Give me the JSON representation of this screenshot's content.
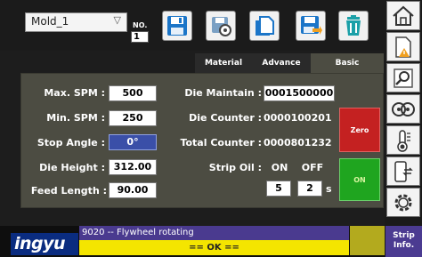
{
  "header": {
    "mold_select": "Mold_1",
    "no_label": "NO.",
    "no_value": "1",
    "toolbar_icons": [
      "save-icon",
      "settings-save-icon",
      "copy-icon",
      "save-as-icon",
      "delete-icon"
    ]
  },
  "tabs": [
    {
      "label": "Material",
      "active": false
    },
    {
      "label": "Advance",
      "active": false
    },
    {
      "label": "Basic",
      "active": true
    }
  ],
  "fields": {
    "max_spm": {
      "label": "Max. SPM :",
      "value": "500"
    },
    "min_spm": {
      "label": "Min. SPM :",
      "value": "250"
    },
    "stop_angle": {
      "label": "Stop Angle :",
      "value": "0°"
    },
    "die_height": {
      "label": "Die Height :",
      "value": "312.00"
    },
    "feed_length": {
      "label": "Feed Length :",
      "value": "90.00"
    },
    "die_maintain": {
      "label": "Die Maintain :",
      "value": "0001500000"
    },
    "die_counter": {
      "label": "Die Counter :",
      "value": "0000100201"
    },
    "total_counter": {
      "label": "Total Counter :",
      "value": "0000801232"
    },
    "strip_oil": {
      "label": "Strip Oil :",
      "on_label": "ON",
      "off_label": "OFF",
      "on_value": "5",
      "off_value": "2",
      "unit": "s"
    }
  },
  "buttons": {
    "zero": "Zero",
    "on": "ON"
  },
  "sidebar_icons": [
    "home-icon",
    "alarm-document-icon",
    "search-icon",
    "motor-icon",
    "temperature-icon",
    "device-transfer-icon",
    "gear-icon"
  ],
  "status": {
    "logo": "ingyu",
    "message": "9020   -- Flywheel rotating",
    "ok": "== OK ==",
    "strip_info": "Strip Info."
  },
  "colors": {
    "stop_angle_field": "#3a4fa8",
    "zero_button": "#c42121",
    "on_button": "#1fa51f",
    "status_message_bg": "#4a3a8f",
    "ok_bar": "#f4e500",
    "tab_active": "#4c4c42"
  }
}
